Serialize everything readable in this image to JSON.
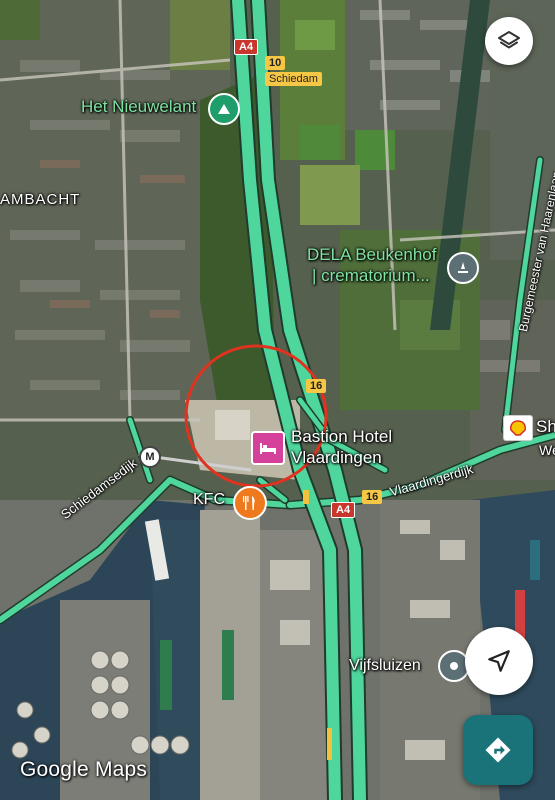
{
  "map": {
    "places": {
      "nieuwelant": "Het Nieuwelant",
      "ambacht": "AMBACHT",
      "dela_line1": "DELA Beukenhof",
      "dela_line2": "| crematorium...",
      "bastion_line1": "Bastion Hotel",
      "bastion_line2": "Vlaardingen",
      "kfc": "KFC",
      "vijfsluizen": "Vijfsluizen",
      "shell": "Sh",
      "we": "We"
    },
    "streets": {
      "schiedamsedijk": "Schiedamsedijk",
      "vlaardingerdijk": "Vlaardingerdijk",
      "burgemeester": "Burgemeester van Haarenlaan"
    },
    "road_shields": {
      "a4_top": "A4",
      "a4_bottom": "A4",
      "r10": "10",
      "r16_upper": "16",
      "r16_lower": "16"
    },
    "shield_labels": {
      "schiedam": "Schiedam"
    },
    "metro_label": "M"
  },
  "controls": {
    "layers_icon": "layers-icon",
    "nav_icon": "navigation-arrow-icon",
    "directions_icon": "directions-icon"
  },
  "branding": {
    "watermark": "Google Maps"
  },
  "colors": {
    "traffic_green": "#4fd69c",
    "highlight_circle": "#e0331f",
    "hotel_pink": "#d4409a",
    "poi_green": "#1e9e6a",
    "kfc_orange": "#ef7a1e",
    "directions_teal": "#1a7379"
  }
}
